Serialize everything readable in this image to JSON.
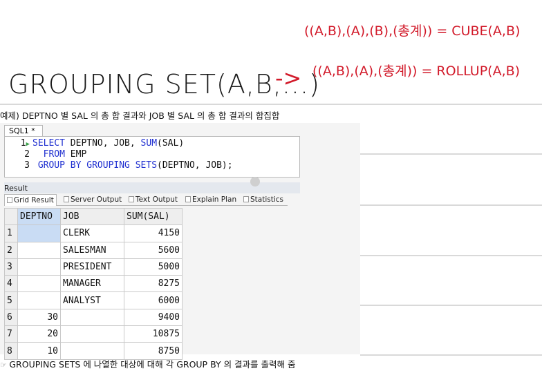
{
  "annotations": {
    "main": "GROUPING SET(A,B,...)",
    "arrow": "->",
    "cube_line": "((A,B),(A),(B),(총계)) = CUBE(A,B)",
    "rollup_line": "((A,B),(A),(총계)) = ROLLUP(A,B)",
    "colors": {
      "ink": "#1a1a1a",
      "red": "#d21a2a"
    }
  },
  "heading": "예제) DEPTNO 별 SAL 의 총 합 결과와 JOB 별 SAL 의 총 합 결과의 합집합",
  "editor": {
    "tab_label": "SQL1 *",
    "lines": [
      {
        "num": "1",
        "kw1": "SELECT",
        "rest": " DEPTNO, JOB, ",
        "kw2": "SUM",
        "tail": "(SAL)"
      },
      {
        "num": "2",
        "kw1": "FROM",
        "rest": " EMP",
        "kw2": "",
        "tail": ""
      },
      {
        "num": "3",
        "kw1": "GROUP BY GROUPING SETS",
        "rest": "(DEPTNO, JOB);",
        "kw2": "",
        "tail": ""
      }
    ]
  },
  "result": {
    "label": "Result",
    "tabs": [
      "Grid Result",
      "Server Output",
      "Text Output",
      "Explain Plan",
      "Statistics"
    ],
    "columns": [
      "DEPTNO",
      "JOB",
      "SUM(SAL)"
    ],
    "rows": [
      {
        "rn": "1",
        "deptno": "",
        "job": "CLERK",
        "sal": "4150"
      },
      {
        "rn": "2",
        "deptno": "",
        "job": "SALESMAN",
        "sal": "5600"
      },
      {
        "rn": "3",
        "deptno": "",
        "job": "PRESIDENT",
        "sal": "5000"
      },
      {
        "rn": "4",
        "deptno": "",
        "job": "MANAGER",
        "sal": "8275"
      },
      {
        "rn": "5",
        "deptno": "",
        "job": "ANALYST",
        "sal": "6000"
      },
      {
        "rn": "6",
        "deptno": "30",
        "job": "",
        "sal": "9400"
      },
      {
        "rn": "7",
        "deptno": "20",
        "job": "",
        "sal": "10875"
      },
      {
        "rn": "8",
        "deptno": "10",
        "job": "",
        "sal": "8750"
      }
    ]
  },
  "footer": "GROUPING SETS 에 나열한 대상에 대해 각 GROUP BY 의 결과를 출력해 줌"
}
